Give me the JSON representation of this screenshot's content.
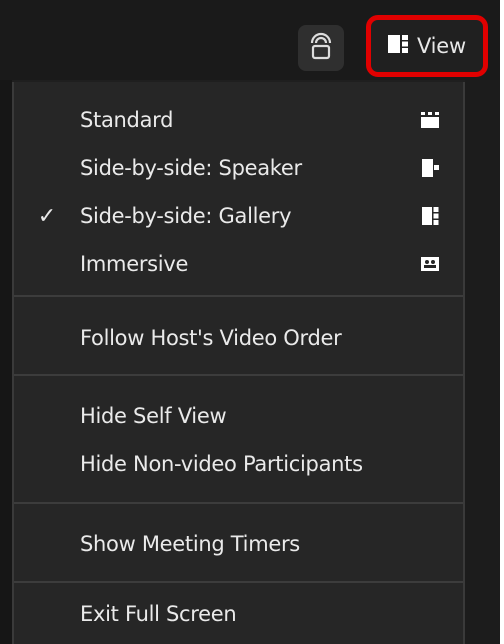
{
  "toolbar": {
    "lock_icon": "headset-lock-icon",
    "view_icon": "gallery-layout-icon",
    "view_label": "View",
    "highlight_color": "#e00000"
  },
  "menu": {
    "layouts": [
      {
        "label": "Standard",
        "icon": "standard-grid-icon",
        "checked": false
      },
      {
        "label": "Side-by-side: Speaker",
        "icon": "side-speaker-icon",
        "checked": false
      },
      {
        "label": "Side-by-side: Gallery",
        "icon": "side-gallery-icon",
        "checked": true
      },
      {
        "label": "Immersive",
        "icon": "immersive-icon",
        "checked": false
      }
    ],
    "check_mark": "✓",
    "follow_host": "Follow Host's Video Order",
    "hide_self_view": "Hide Self View",
    "hide_non_video": "Hide Non-video Participants",
    "show_timers": "Show Meeting Timers",
    "exit_full_screen": "Exit Full Screen"
  }
}
